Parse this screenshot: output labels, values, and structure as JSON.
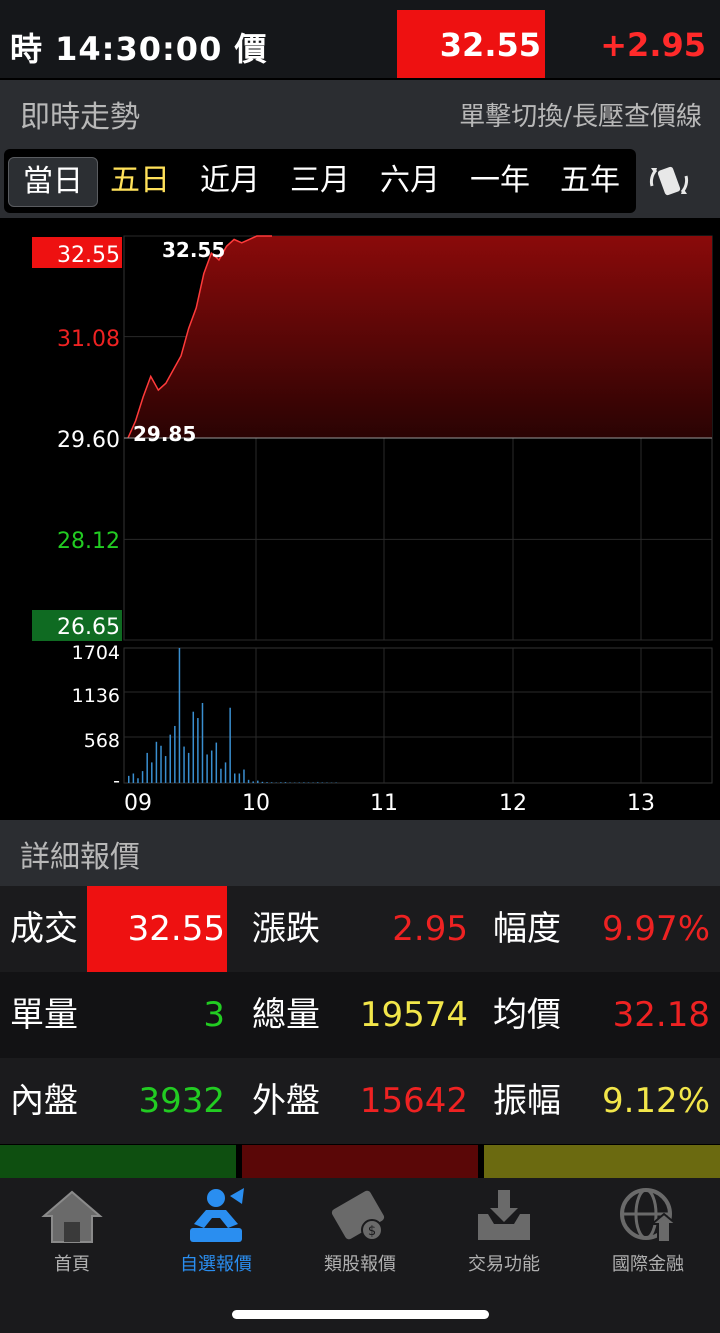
{
  "topbar": {
    "time_label": "時 14:30:00 價",
    "price": "32.55",
    "change": "+2.95"
  },
  "trend_section": {
    "title": "即時走勢",
    "hint": "單擊切換/長壓查價線"
  },
  "range_tabs": [
    {
      "label": "當日"
    },
    {
      "label": "五日"
    },
    {
      "label": "近月"
    },
    {
      "label": "三月"
    },
    {
      "label": "六月"
    },
    {
      "label": "一年"
    },
    {
      "label": "五年"
    }
  ],
  "rotate_icon": "rotate-screen-icon",
  "chart_data": {
    "type": "area",
    "price_axis": {
      "ticks": [
        "32.55",
        "31.08",
        "29.60",
        "28.12",
        "26.65"
      ],
      "values": [
        32.55,
        31.08,
        29.6,
        28.12,
        26.65
      ],
      "ylim": [
        26.65,
        32.55
      ],
      "reference": 29.6
    },
    "labels": {
      "high": "32.55",
      "low": "29.85"
    },
    "x_ticks": [
      "09",
      "10",
      "11",
      "12",
      "13"
    ],
    "series": [
      {
        "values": [
          29.6,
          29.85,
          30.2,
          30.5,
          30.3,
          30.4,
          30.6,
          30.8,
          31.2,
          31.5,
          32.0,
          32.3,
          32.2,
          32.4,
          32.5,
          32.45,
          32.5,
          32.55,
          32.55,
          32.55
        ]
      }
    ],
    "volume_axis": {
      "ticks": [
        "1704",
        "1136",
        "568",
        "-"
      ],
      "ylim": [
        0,
        1704
      ]
    },
    "volume": [
      90,
      120,
      60,
      150,
      380,
      260,
      520,
      470,
      340,
      610,
      720,
      1704,
      460,
      380,
      900,
      820,
      1010,
      360,
      410,
      510,
      180,
      260,
      950,
      120,
      120,
      170,
      40,
      20,
      30,
      15,
      10,
      8,
      5,
      8,
      10,
      6,
      5,
      6,
      7,
      6,
      5,
      8,
      6,
      5,
      4,
      5
    ]
  },
  "detail_section": {
    "title": "詳細報價"
  },
  "quote": {
    "rows": [
      [
        {
          "label": "成交",
          "value": "32.55"
        },
        {
          "label": "漲跌",
          "value": "2.95"
        },
        {
          "label": "幅度",
          "value": "9.97%"
        }
      ],
      [
        {
          "label": "單量",
          "value": "3"
        },
        {
          "label": "總量",
          "value": "19574"
        },
        {
          "label": "均價",
          "value": "32.18"
        }
      ],
      [
        {
          "label": "內盤",
          "value": "3932"
        },
        {
          "label": "外盤",
          "value": "15642"
        },
        {
          "label": "振幅",
          "value": "9.12%"
        }
      ]
    ],
    "colors": {
      "red": "#ee2222",
      "green": "#22cc22",
      "yellow": "#f2e64a",
      "price_bg": "#ee1111"
    }
  },
  "nav": [
    {
      "label": "首頁",
      "icon": "home-icon"
    },
    {
      "label": "自選報價",
      "icon": "watchlist-icon"
    },
    {
      "label": "類股報價",
      "icon": "sector-film-icon"
    },
    {
      "label": "交易功能",
      "icon": "trade-inbox-icon"
    },
    {
      "label": "國際金融",
      "icon": "globe-icon"
    }
  ]
}
